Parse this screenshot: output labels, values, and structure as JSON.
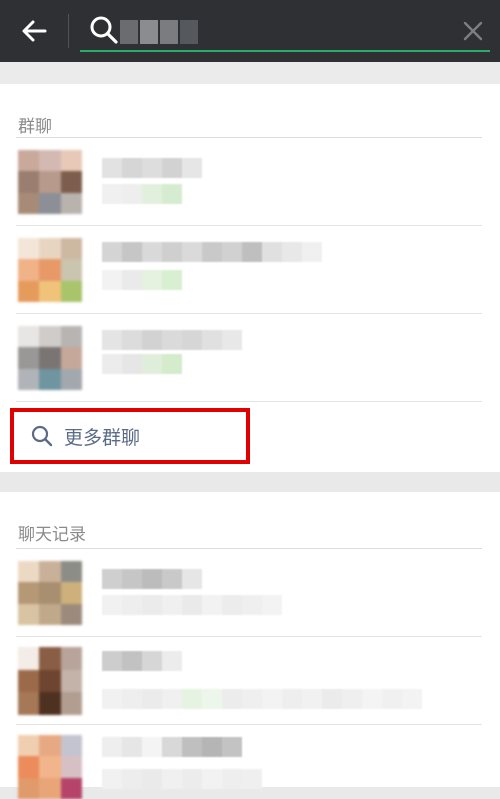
{
  "search": {
    "query": ""
  },
  "group_section": {
    "title": "群聊",
    "more_label": "更多群聊"
  },
  "chat_section": {
    "title": "聊天记录"
  },
  "colors": {
    "topbar": "#2e3034",
    "accent_green": "#2aae67",
    "highlight_red": "#e00000",
    "link_blue": "#5b6b86"
  },
  "icons": [
    "back-arrow-icon",
    "search-icon",
    "close-icon"
  ]
}
